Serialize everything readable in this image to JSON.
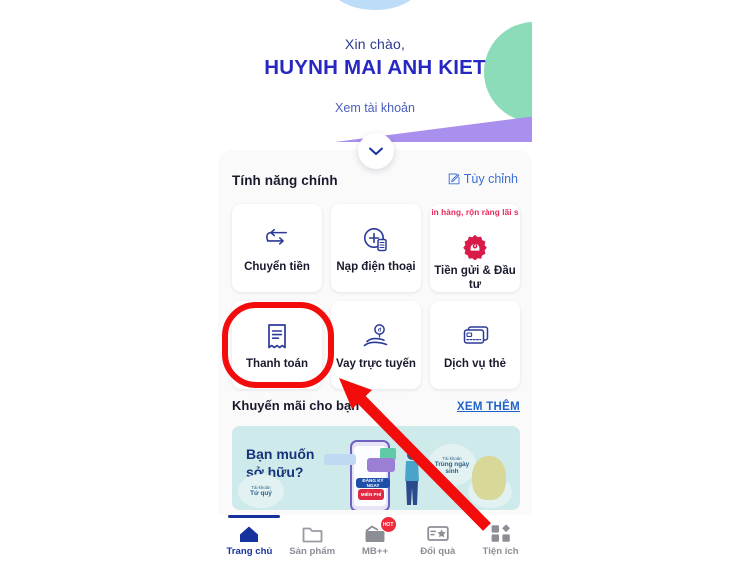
{
  "app": {
    "brand_blue": "#2727c4",
    "accent_red": "#f30c0c",
    "nav_active_color": "#16329c"
  },
  "hero": {
    "greeting": "Xin chào,",
    "user_name": "HUYNH MAI ANH KIET",
    "view_account_link": "Xem tài khoản",
    "expand_icon": "chevron-down-icon"
  },
  "main_features": {
    "section_title": "Tính năng chính",
    "customize_label": "Tùy chỉnh",
    "customize_icon": "edit-square-icon",
    "tiles": [
      {
        "label": "Chuyển tiền",
        "icon": "transfer-arrows-icon",
        "promo_text": ""
      },
      {
        "label": "Nạp điện thoại",
        "icon": "topup-plus-icon",
        "promo_text": ""
      },
      {
        "label": "Tiền gửi & Đầu tư",
        "icon": "savings-badge-icon",
        "promo_text": "in hàng, rộn ràng lãi s"
      },
      {
        "label": "Thanh toán",
        "icon": "receipt-icon",
        "promo_text": ""
      },
      {
        "label": "Vay trực tuyến",
        "icon": "loan-hand-coin-icon",
        "promo_text": ""
      },
      {
        "label": "Dịch vụ thẻ",
        "icon": "cards-icon",
        "promo_text": ""
      }
    ]
  },
  "promotions": {
    "section_title": "Khuyến mãi cho bạn",
    "see_more_label": "XEM THÊM",
    "banner": {
      "headline_line1": "Bạn muốn",
      "headline_line2": "sở hữu?",
      "bubble_left_top": "Tài khoản",
      "bubble_left_main": "Tứ quý",
      "bubble_right_top": "Tài khoản",
      "bubble_right_main": "Trùng ngày sinh",
      "chip_register": "ĐĂNG KÝ NGAY",
      "chip_free": "MIỄN PHÍ"
    }
  },
  "bottom_nav": {
    "items": [
      {
        "label": "Trang chủ",
        "icon": "home-icon",
        "active": true,
        "badge": ""
      },
      {
        "label": "Sản phẩm",
        "icon": "folder-icon",
        "active": false,
        "badge": ""
      },
      {
        "label": "MB++",
        "icon": "wallet-icon",
        "active": false,
        "badge": "HOT"
      },
      {
        "label": "Đổi quà",
        "icon": "gift-card-star-icon",
        "active": false,
        "badge": ""
      },
      {
        "label": "Tiện ích",
        "icon": "grid-apps-icon",
        "active": false,
        "badge": ""
      }
    ]
  },
  "annotations": {
    "highlight_shape": "red-rounded-rectangle",
    "highlight_target": "Thanh toán",
    "pointer_shape": "red-arrow",
    "pointer_color": "#f30c0c"
  }
}
